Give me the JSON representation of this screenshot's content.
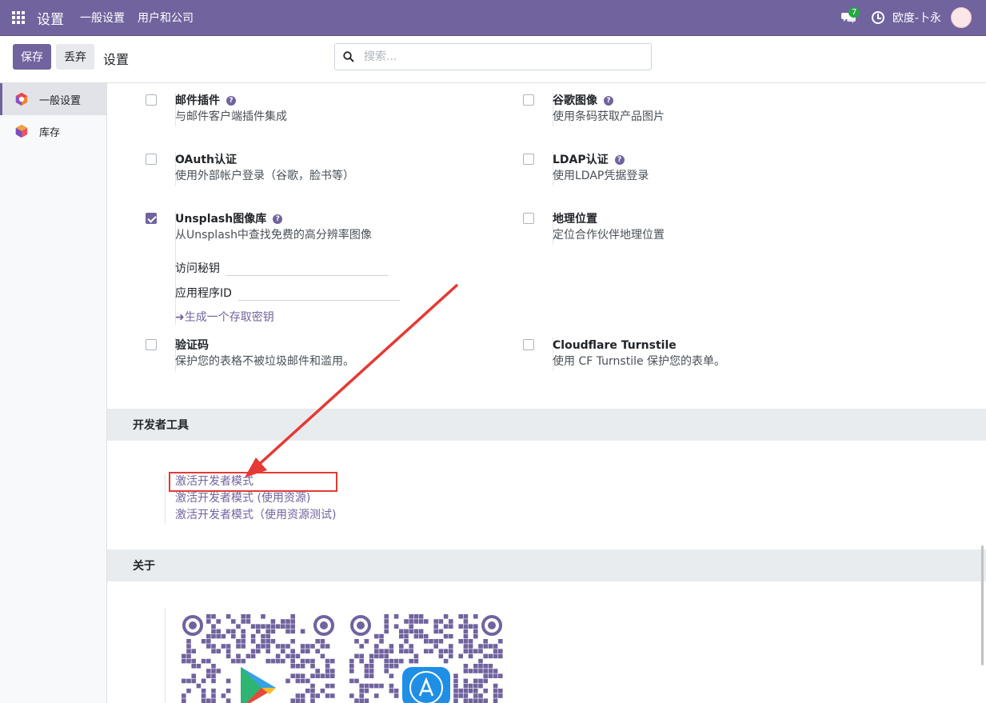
{
  "navbar": {
    "app_title": "设置",
    "menus": [
      "一般设置",
      "用户和公司"
    ],
    "chat_count": "7",
    "user_name": "欧度-卜永"
  },
  "control": {
    "save": "保存",
    "discard": "丢弃",
    "breadcrumb": "设置",
    "search_placeholder": "搜索..."
  },
  "sidebar": {
    "items": [
      {
        "label": "一般设置",
        "icon": "general-settings-hex-icon",
        "active": true
      },
      {
        "label": "库存",
        "icon": "inventory-hex-icon",
        "active": false
      }
    ]
  },
  "settings": {
    "mail_plugin": {
      "title": "邮件插件",
      "desc": "与邮件客户端插件集成",
      "checked": false
    },
    "google_images": {
      "title": "谷歌图像",
      "desc": "使用条码获取产品图片",
      "checked": false
    },
    "oauth": {
      "title": "OAuth认证",
      "desc": "使用外部帐户登录（谷歌，脸书等）",
      "checked": false
    },
    "ldap": {
      "title": "LDAP认证",
      "desc": "使用LDAP凭据登录",
      "checked": false
    },
    "unsplash": {
      "title": "Unsplash图像库",
      "desc": "从Unsplash中查找免费的高分辨率图像",
      "checked": true,
      "access_key_label": "访问秘钥",
      "app_id_label": "应用程序ID",
      "generate_link": "➜生成一个存取密钥"
    },
    "geo": {
      "title": "地理位置",
      "desc": "定位合作伙伴地理位置",
      "checked": false
    },
    "captcha": {
      "title": "验证码",
      "desc": "保护您的表格不被垃圾邮件和滥用。",
      "checked": false
    },
    "turnstile": {
      "title": "Cloudflare Turnstile",
      "desc": "使用 CF Turnstile 保护您的表单。",
      "checked": false
    }
  },
  "developer": {
    "heading": "开发者工具",
    "links": [
      "激活开发者模式",
      "激活开发者模式 (使用资源)",
      "激活开发者模式（使用资源测试)"
    ]
  },
  "about": {
    "heading": "关于"
  },
  "colors": {
    "brand": "#71639e",
    "annotation": "#e53935"
  }
}
